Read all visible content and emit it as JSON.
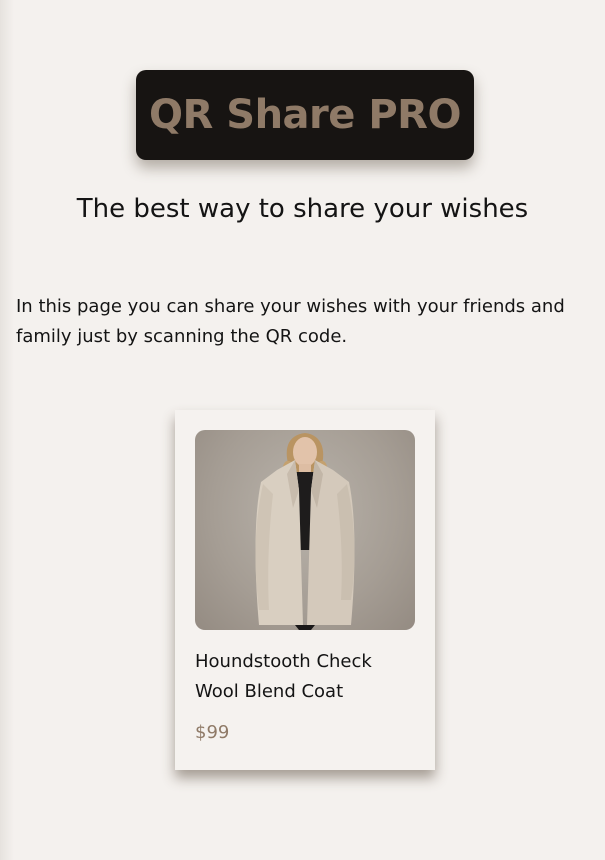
{
  "header": {
    "logo_text": "QR Share PRO",
    "tagline": "The best way to share your wishes"
  },
  "intro": {
    "text": "In this page you can share your wishes with your friends and family just by scanning the QR code."
  },
  "product": {
    "name": "Houndstooth Check Wool Blend Coat",
    "price": "$99"
  },
  "colors": {
    "background": "#f4f1ee",
    "logo_background": "#171412",
    "accent": "#8f7a67",
    "text": "#141414"
  }
}
